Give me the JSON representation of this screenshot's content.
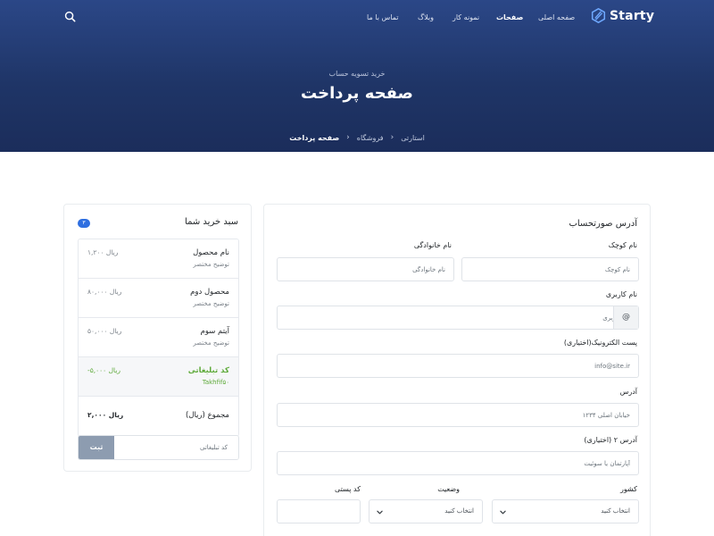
{
  "header": {
    "logo_text": "Starty",
    "nav": [
      "صفحه اصلی",
      "صفحات",
      "نمونه کار",
      "وبلاگ",
      "تماس با ما"
    ],
    "active_nav": "صفحات",
    "subtitle": "خرید تسویه حساب",
    "title": "صفحه پرداخت",
    "breadcrumb": [
      "استارتی",
      "فروشگاه",
      "صفحه پرداخت"
    ]
  },
  "cart": {
    "title": "سبد خرید شما",
    "count": "۳",
    "items": [
      {
        "name": "نام محصول",
        "desc": "توضیح مختصر",
        "price": "۱,۲۰۰ ریال"
      },
      {
        "name": "محصول دوم",
        "desc": "توضیح مختصر",
        "price": "۸۰,۰۰۰ ریال"
      },
      {
        "name": "آیتم سوم",
        "desc": "توضیح مختصر",
        "price": "۵۰,۰۰۰ ریال"
      }
    ],
    "promo": {
      "name": "کد تبلیغاتی",
      "code": "Takhfif۵۰",
      "amount": "-۵,۰۰۰ ریال"
    },
    "total": {
      "label": "مجموع (ریال)",
      "amount": "۲,۰۰۰ ریال"
    },
    "promo_placeholder": "کد تبلیغاتی",
    "promo_button": "ثبت"
  },
  "billing": {
    "title": "آدرس صورتحساب",
    "first_name": {
      "label": "نام کوچک",
      "placeholder": "نام کوچک"
    },
    "last_name": {
      "label": "نام خانوادگی",
      "placeholder": "نام خانوادگی"
    },
    "username": {
      "label": "نام کاربری",
      "placeholder": "نام کاربری",
      "addon": "@"
    },
    "email": {
      "label": "پست الکترونیک",
      "optional": "(اختیاری)",
      "placeholder": "info@site.ir"
    },
    "address": {
      "label": "آدرس",
      "placeholder": "خیابان اصلی ۱۲۳۴"
    },
    "address2": {
      "label": "آدرس ۲",
      "optional": "(اختیاری)",
      "placeholder": "آپارتمان یا سوئیت"
    },
    "country": {
      "label": "کشور",
      "value": "انتخاب کنید"
    },
    "state": {
      "label": "وضعیت",
      "value": "انتخاب کنید"
    },
    "zip": {
      "label": "کد پستی",
      "placeholder": ""
    }
  }
}
